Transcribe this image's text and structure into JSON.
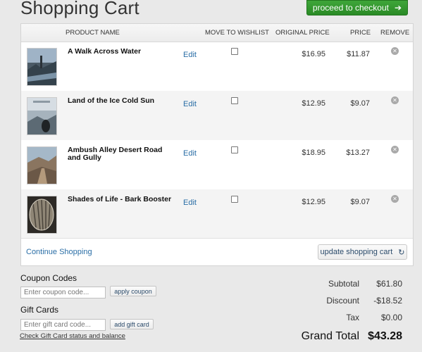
{
  "page": {
    "title": "Shopping Cart"
  },
  "checkout_button": {
    "label": "proceed to checkout"
  },
  "table": {
    "headers": {
      "product_name": "PRODUCT NAME",
      "move_to_wishlist": "MOVE TO WISHLIST",
      "original_price": "ORIGINAL PRICE",
      "price": "PRICE",
      "remove": "REMOVE"
    },
    "rows": [
      {
        "name": "A Walk Across Water",
        "edit": "Edit",
        "original_price": "$16.95",
        "price": "$11.87",
        "wishlist_checked": false
      },
      {
        "name": "Land of the Ice Cold Sun",
        "edit": "Edit",
        "original_price": "$12.95",
        "price": "$9.07",
        "wishlist_checked": false
      },
      {
        "name": "Ambush Alley Desert Road and Gully",
        "edit": "Edit",
        "original_price": "$18.95",
        "price": "$13.27",
        "wishlist_checked": false
      },
      {
        "name": "Shades of Life - Bark Booster",
        "edit": "Edit",
        "original_price": "$12.95",
        "price": "$9.07",
        "wishlist_checked": false
      }
    ]
  },
  "cart_footer": {
    "continue_shopping": "Continue Shopping",
    "update_cart": "update shopping cart"
  },
  "coupon": {
    "label": "Coupon Codes",
    "placeholder": "Enter coupon code...",
    "button": "apply coupon"
  },
  "gift_card": {
    "label": "Gift Cards",
    "placeholder": "Enter gift card code...",
    "button": "add gift card",
    "status_link": "Check Gift Card status and balance"
  },
  "totals": {
    "subtotal_label": "Subtotal",
    "subtotal": "$61.80",
    "discount_label": "Discount",
    "discount": "-$18.52",
    "tax_label": "Tax",
    "tax": "$0.00",
    "grand_total_label": "Grand Total",
    "grand_total": "$43.28"
  },
  "colors": {
    "checkout_green": "#2f9a2b",
    "link_blue": "#2a6ea6"
  }
}
